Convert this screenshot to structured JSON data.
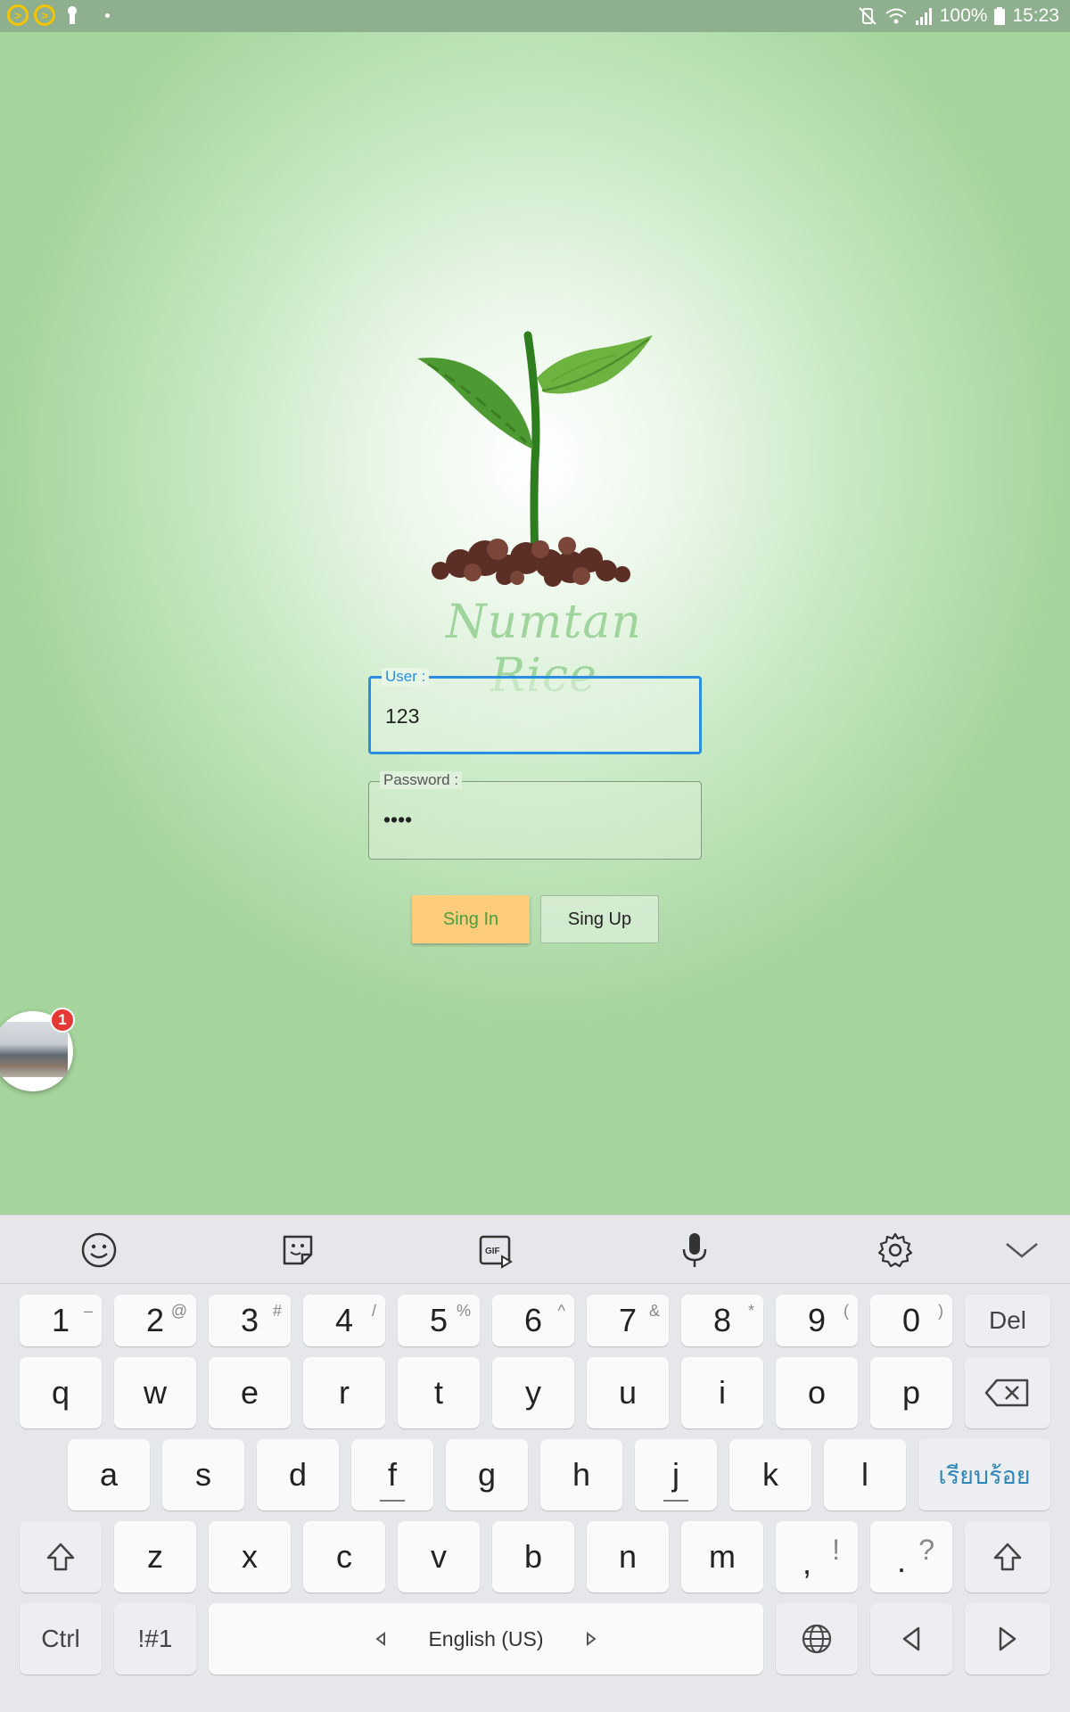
{
  "status_bar": {
    "left_icons": [
      "plex-icon",
      "plex-icon",
      "keyhole-icon",
      "dot-icon"
    ],
    "right_icons": [
      "mute-vibrate-icon",
      "wifi-icon",
      "signal-icon"
    ],
    "battery": "100%",
    "time": "15:23"
  },
  "app": {
    "brand": "Numtan Rice",
    "user_label": "User :",
    "user_value": "123",
    "password_label": "Password :",
    "password_value": "••••",
    "signin_label": "Sing In",
    "signup_label": "Sing Up"
  },
  "chat_bubble": {
    "badge_count": "1"
  },
  "keyboard": {
    "toolbar_icons": [
      "emoji-icon",
      "sticker-icon",
      "gif-icon",
      "microphone-icon",
      "settings-icon",
      "collapse-icon"
    ],
    "number_row": [
      {
        "label": "1",
        "sup": "–"
      },
      {
        "label": "2",
        "sup": "@"
      },
      {
        "label": "3",
        "sup": "#"
      },
      {
        "label": "4",
        "sup": "/"
      },
      {
        "label": "5",
        "sup": "%"
      },
      {
        "label": "6",
        "sup": "^"
      },
      {
        "label": "7",
        "sup": "&"
      },
      {
        "label": "8",
        "sup": "*"
      },
      {
        "label": "9",
        "sup": "("
      },
      {
        "label": "0",
        "sup": ")"
      }
    ],
    "del_label": "Del",
    "row_q": [
      "q",
      "w",
      "e",
      "r",
      "t",
      "y",
      "u",
      "i",
      "o",
      "p"
    ],
    "row_a": [
      "a",
      "s",
      "d",
      "f",
      "g",
      "h",
      "j",
      "k",
      "l"
    ],
    "done_label": "เรียบร้อย",
    "row_z": [
      "z",
      "x",
      "c",
      "v",
      "b",
      "n",
      "m"
    ],
    "comma": ",",
    "comma_sup": "!",
    "period": ".",
    "period_sup": "?",
    "ctrl_label": "Ctrl",
    "symbols_label": "!#1",
    "space_label": "English (US)"
  }
}
